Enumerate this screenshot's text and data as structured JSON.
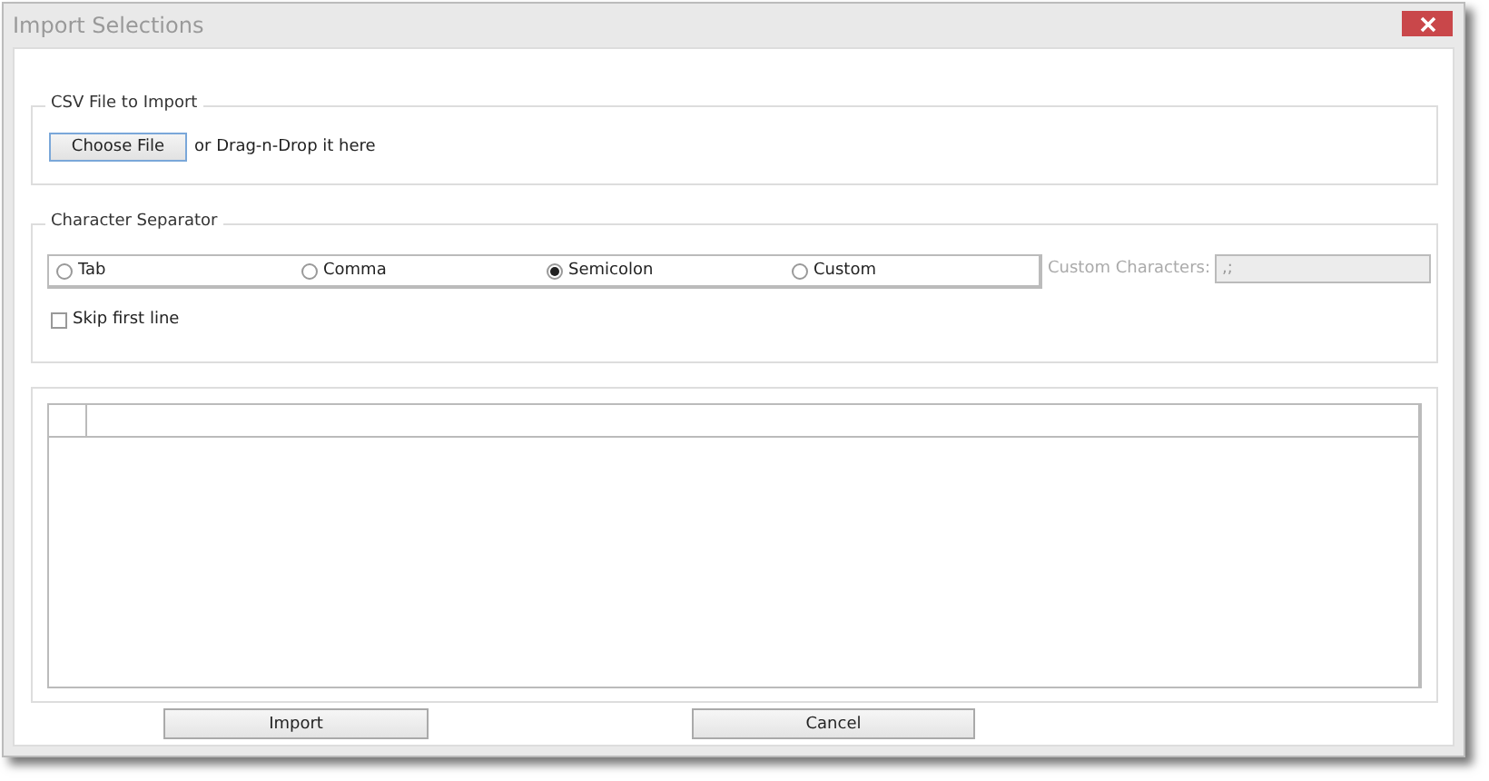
{
  "window": {
    "title": "Import Selections"
  },
  "file_group": {
    "legend": "CSV File to Import",
    "button": "Choose File",
    "hint": "or Drag-n-Drop it here"
  },
  "separator_group": {
    "legend": "Character Separator",
    "options": [
      {
        "label": "Tab",
        "selected": false
      },
      {
        "label": "Comma",
        "selected": false
      },
      {
        "label": "Semicolon",
        "selected": true
      },
      {
        "label": "Custom",
        "selected": false
      }
    ],
    "custom_label": "Custom Characters:",
    "custom_value": ",;",
    "custom_disabled": true,
    "skip_first_line": {
      "label": "Skip first line",
      "checked": false
    }
  },
  "buttons": [
    "Import",
    "Cancel"
  ]
}
